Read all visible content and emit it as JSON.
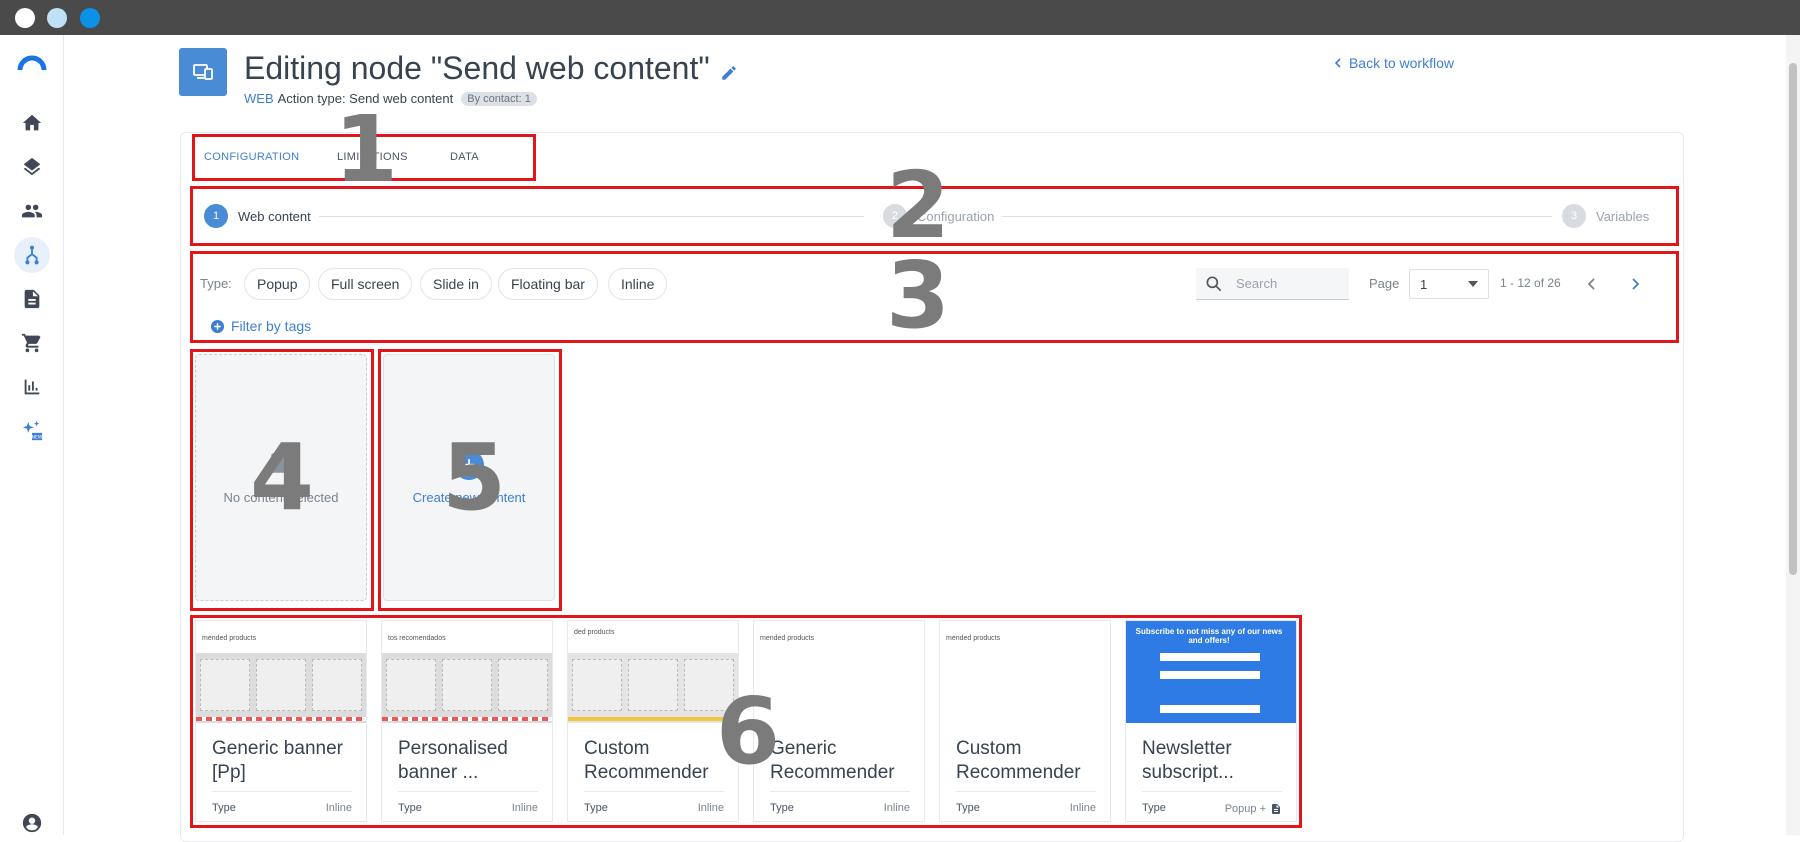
{
  "window": {
    "controls": [
      "close",
      "minimize",
      "maximize"
    ]
  },
  "sidebar": {
    "items": [
      {
        "name": "home-icon"
      },
      {
        "name": "layers-icon"
      },
      {
        "name": "people-icon"
      },
      {
        "name": "workflow-icon",
        "active": true
      },
      {
        "name": "document-icon"
      },
      {
        "name": "cart-icon"
      },
      {
        "name": "chart-icon"
      },
      {
        "name": "sparkles-new-icon",
        "badge": "NEW"
      },
      {
        "name": "account-icon"
      }
    ]
  },
  "header": {
    "title": "Editing node \"Send web content\"",
    "channel": "WEB",
    "action_type": "Action type: Send web content",
    "badge": "By contact: 1",
    "back_link": "Back to workflow"
  },
  "tabs": [
    {
      "label": "CONFIGURATION",
      "active": true
    },
    {
      "label": "LIMITATIONS"
    },
    {
      "label": "DATA"
    }
  ],
  "stepper": [
    {
      "num": "1",
      "label": "Web content",
      "active": true
    },
    {
      "num": "2",
      "label": "Configuration"
    },
    {
      "num": "3",
      "label": "Variables"
    }
  ],
  "filters": {
    "type_label": "Type:",
    "types": [
      "Popup",
      "Full screen",
      "Slide in",
      "Floating bar",
      "Inline"
    ],
    "filter_by_tags": "Filter by tags",
    "search_placeholder": "Search",
    "page_label": "Page",
    "page_value": "1",
    "range": "1 - 12 of 26"
  },
  "empty_card": {
    "label": "No content selected"
  },
  "create_card": {
    "label": "Create new content"
  },
  "templates": [
    {
      "name": "Generic banner [Pp]",
      "type_label": "Type",
      "type": "Inline",
      "thumb_caption": "mended products"
    },
    {
      "name": "Personalised banner ...",
      "type_label": "Type",
      "type": "Inline",
      "thumb_caption": "tos recomendados"
    },
    {
      "name": "Custom Recommender",
      "type_label": "Type",
      "type": "Inline",
      "thumb_caption": "ded products"
    },
    {
      "name": "Generic Recommender",
      "type_label": "Type",
      "type": "Inline",
      "thumb_caption": "mended products"
    },
    {
      "name": "Custom Recommender",
      "type_label": "Type",
      "type": "Inline",
      "thumb_caption": "mended products"
    },
    {
      "name": "Newsletter subscript...",
      "type_label": "Type",
      "type": "Popup +",
      "thumb_caption": "Subscribe to not miss any of our news and offers!"
    }
  ],
  "annotations": [
    "1",
    "2",
    "3",
    "4",
    "5",
    "6"
  ],
  "colors": {
    "accent": "#3f7fd1",
    "annotation_border": "#e0161b",
    "annotation_number": "#7b7b7b"
  }
}
